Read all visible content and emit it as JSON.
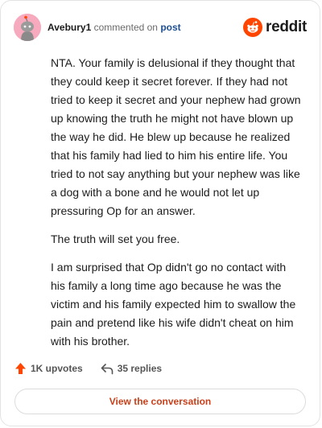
{
  "header": {
    "username": "Avebury1",
    "verb": "commented on",
    "post_link": "post",
    "logo_text": "reddit"
  },
  "comment": {
    "paragraphs": [
      "NTA. Your family is delusional if they thought that they could keep it secret forever. If they had not tried to keep it secret and your nephew had grown up knowing the truth he might not have blown up the way he did. He blew up because he realized that his family had lied to him his entire life. You tried to not say anything but your nephew was like a dog with a bone and he would not let up pressuring Op for an answer.",
      "The truth will set you free.",
      "I am surprised that Op didn't go no contact with his family a long time ago because he was the victim and his family expected him to swallow the pain and pretend like his wife didn't cheat on him with his brother."
    ]
  },
  "actions": {
    "upvotes": "1K upvotes",
    "replies": "35 replies"
  },
  "cta": {
    "label": "View the conversation"
  },
  "colors": {
    "accent": "#c8401b",
    "upvote": "#ff4500",
    "avatar_bg": "#f7a9bd",
    "link": "#1d4f91"
  },
  "icons": {
    "avatar": "snoo-avatar-icon",
    "logo": "reddit-snoo-icon",
    "upvote": "upvote-arrow-icon",
    "reply": "reply-arrow-icon"
  }
}
